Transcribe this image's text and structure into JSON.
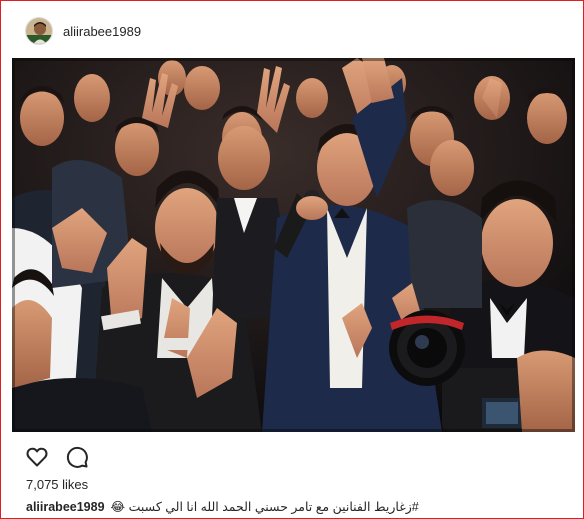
{
  "post": {
    "username": "aliirabee1989",
    "avatar_icon": "profile-avatar-photo",
    "photo_description_icon": "wedding-celebration-photo",
    "likes": "7,075 likes",
    "caption_user": "aliirabee1989",
    "caption_text": "#زغاريط الفنانين مع تامر حسني الحمد الله انا الي كسبت 😂"
  },
  "icons": {
    "like": "heart-icon",
    "comment": "comment-bubble-icon"
  },
  "colors": {
    "frame_border": "#e02020",
    "text": "#262626"
  }
}
